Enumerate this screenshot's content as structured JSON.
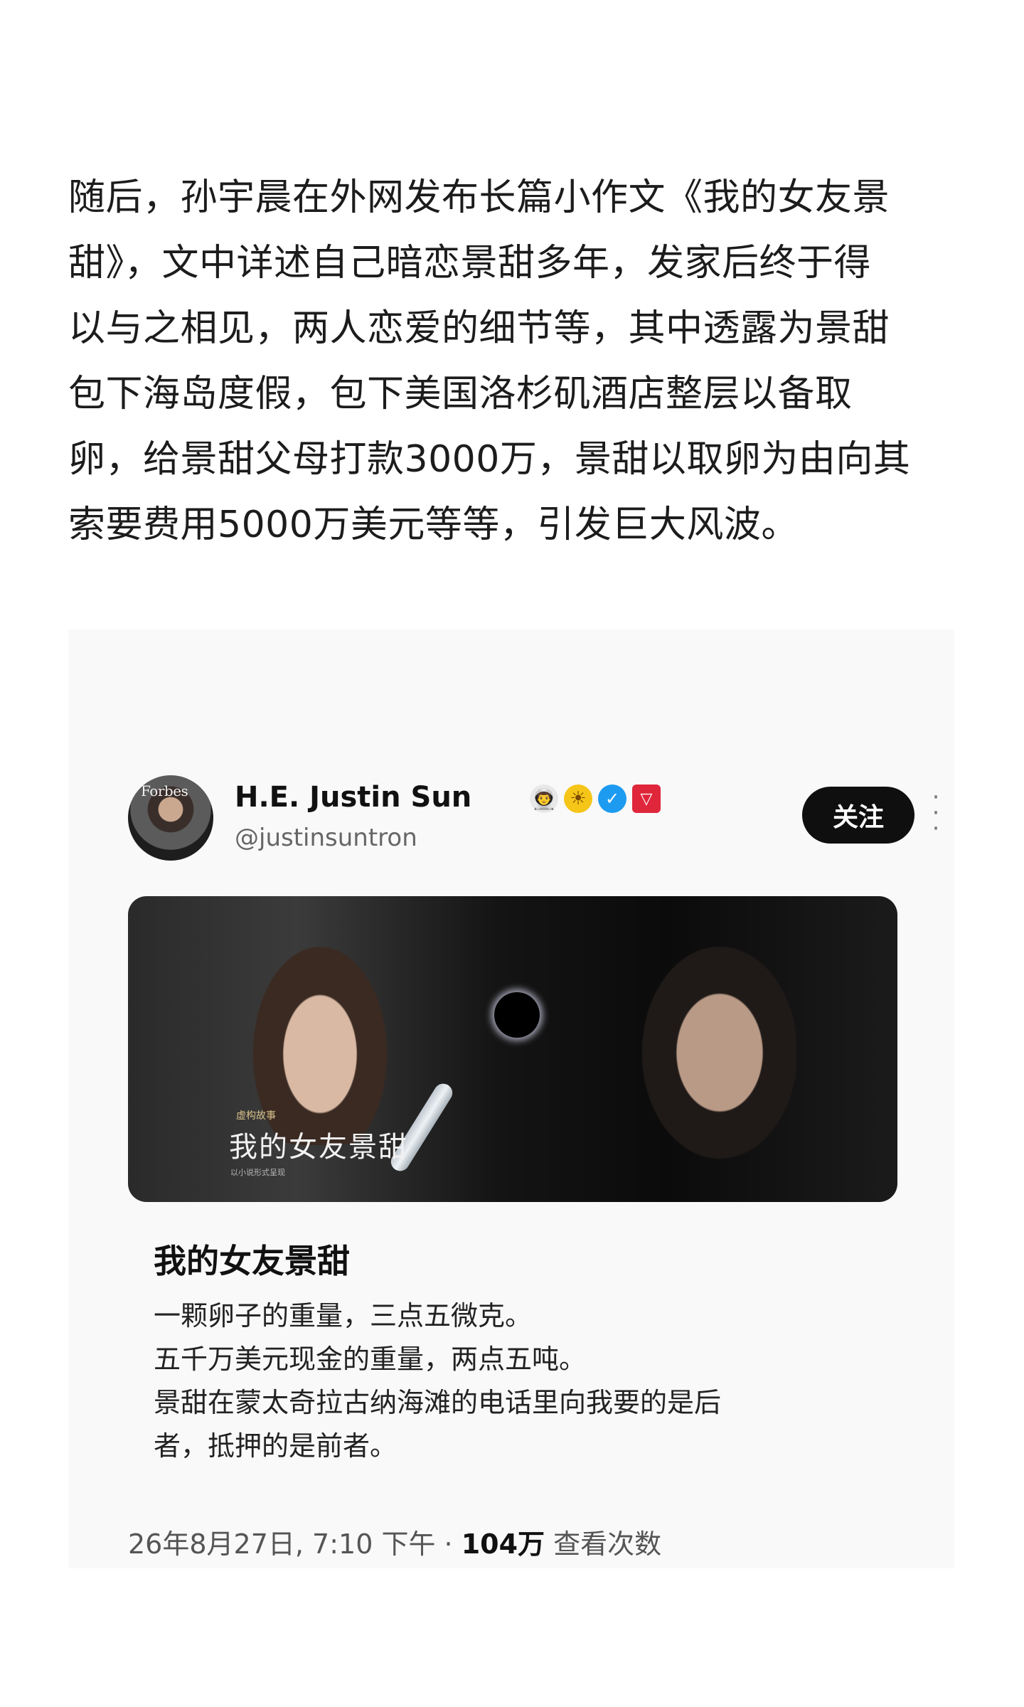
{
  "article": {
    "lines": [
      "随后，孙宇晨在外网发布长篇小作文《我的女友景",
      "甜》，文中详述自己暗恋景甜多年，发家后终于得",
      "以与之相见，两人恋爱的细节等，其中透露为景甜",
      "包下海岛度假，包下美国洛杉矶酒店整层以备取",
      "卵，给景甜父母打款3000万，景甜以取卵为由向其",
      "索要费用5000万美元等等，引发巨大风波。"
    ]
  },
  "tweet": {
    "avatar_text": "Forbes",
    "display_name": "H.E. Justin Sun",
    "badges": [
      {
        "icon": "astronaut-icon",
        "glyph": "👨‍🚀"
      },
      {
        "icon": "sun-icon",
        "glyph": "☀"
      },
      {
        "icon": "verified-icon",
        "glyph": "✓"
      },
      {
        "icon": "tron-icon",
        "glyph": "▽"
      }
    ],
    "handle": "@justinsuntron",
    "follow_label": "关注",
    "more_glyph": "⋮",
    "media": {
      "tag": "虚构故事",
      "title": "我的女友景甜",
      "subtitle": "以小说形式呈现"
    },
    "title": "我的女友景甜",
    "body_lines": [
      "一颗卵子的重量，三点五微克。",
      "五千万美元现金的重量，两点五吨。",
      "景甜在蒙太奇拉古纳海滩的电话里向我要的是后",
      "者，抵押的是前者。"
    ],
    "meta": {
      "datetime": "26年8月27日, 7:10 下午 · ",
      "views_count": "104万",
      "views_label": " 查看次数"
    }
  }
}
